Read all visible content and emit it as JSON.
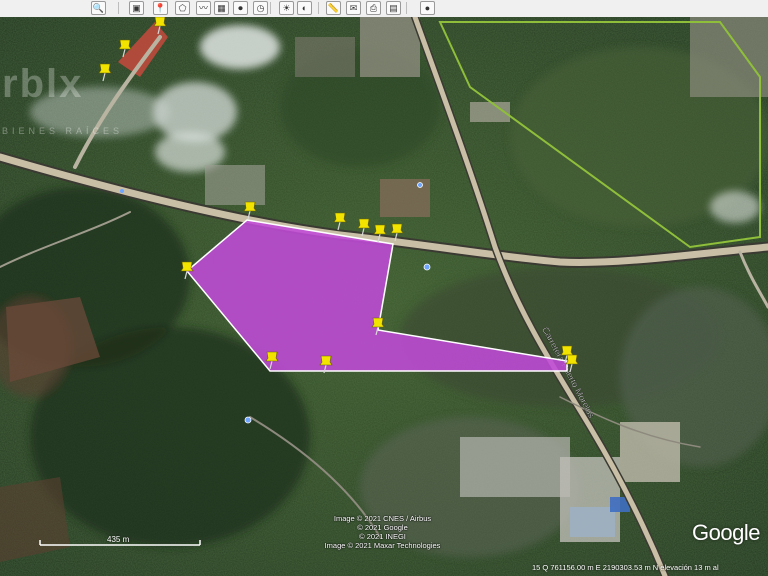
{
  "toolbar": {
    "buttons": [
      {
        "name": "search-tool-icon",
        "glyph": "🔍"
      },
      {
        "name": "sidebar-toggle-icon",
        "glyph": "▣"
      },
      {
        "name": "placemark-icon",
        "glyph": "📍"
      },
      {
        "name": "polygon-tool-icon",
        "glyph": "⬠"
      },
      {
        "name": "path-tool-icon",
        "glyph": "〰"
      },
      {
        "name": "image-overlay-icon",
        "glyph": "▦"
      },
      {
        "name": "record-tour-icon",
        "glyph": "⏺"
      },
      {
        "name": "historical-imagery-icon",
        "glyph": "◷"
      },
      {
        "name": "sunlight-icon",
        "glyph": "☀"
      },
      {
        "name": "planets-icon",
        "glyph": "◐"
      },
      {
        "name": "ruler-icon",
        "glyph": "📏"
      },
      {
        "name": "email-icon",
        "glyph": "✉"
      },
      {
        "name": "print-icon",
        "glyph": "⎙"
      },
      {
        "name": "save-image-icon",
        "glyph": "▤"
      },
      {
        "name": "view-in-maps-icon",
        "glyph": "●"
      }
    ]
  },
  "map": {
    "polygon_fill": "#c04ad8",
    "road_color": "#c9bfa6",
    "road_label": "Carretera Puerto Morelos",
    "pin_color": "#f2e400"
  },
  "watermark": {
    "text": "rblx",
    "subtext": "BIENES RAÍCES"
  },
  "attribution": {
    "lines": [
      "Image © 2021 CNES / Airbus",
      "© 2021 Google",
      "© 2021 INEGI",
      "Image © 2021 Maxar Technologies"
    ]
  },
  "scale": {
    "label": "435 m"
  },
  "status": {
    "coords": "15 Q 761156.00 m E 2190303.53 m N  elevación     13 m     al"
  },
  "brand": {
    "text": "Google"
  }
}
